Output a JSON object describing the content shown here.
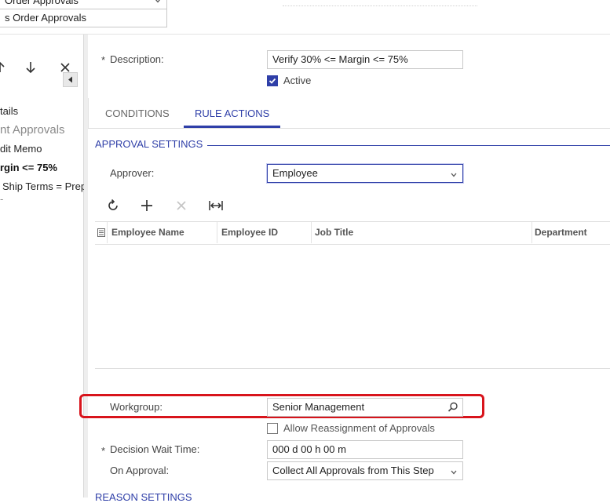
{
  "top": {
    "field1_value": "Order Approvals",
    "field2_value": "s Order Approvals"
  },
  "left": {
    "toolbar": {
      "collapse_icon": "triangle-left-icon",
      "move_up_icon": "arrow-up-icon",
      "move_down_icon": "arrow-down-icon",
      "delete_icon": "close-icon"
    },
    "tree": [
      {
        "label": "tails",
        "style": "normal"
      },
      {
        "label": "nt Approvals",
        "style": "muted"
      },
      {
        "label": "dit Memo",
        "style": "normal"
      },
      {
        "label": "rgin <= 75%",
        "style": "bold"
      },
      {
        "label": "Ship Terms = Prep",
        "style": "normal"
      },
      {
        "label": "-",
        "style": "normal"
      }
    ]
  },
  "form": {
    "description_label": "Description:",
    "description_value": "Verify 30% <= Margin <= 75%",
    "active_label": "Active",
    "active_checked": true,
    "tabs": [
      {
        "label": "CONDITIONS",
        "active": false
      },
      {
        "label": "RULE ACTIONS",
        "active": true
      }
    ],
    "approval_section_title": "APPROVAL SETTINGS",
    "approver_label": "Approver:",
    "approver_value": "Employee",
    "grid_toolbar": [
      "refresh-icon",
      "add-icon",
      "delete-icon",
      "fit-columns-icon"
    ],
    "grid_columns": [
      "Employee Name",
      "Employee ID",
      "Job Title",
      "Department"
    ],
    "workgroup_label": "Workgroup:",
    "workgroup_value": "Senior Management",
    "allow_reassign_label": "Allow Reassignment of Approvals",
    "allow_reassign_checked": false,
    "decision_wait_label": "Decision Wait Time:",
    "decision_wait_value": "000 d 00 h 00 m",
    "on_approval_label": "On Approval:",
    "on_approval_value": "Collect All Approvals from This Step",
    "reason_section_title": "REASON SETTINGS"
  },
  "colors": {
    "accent": "#2f3fa8",
    "highlight_box": "#d8141c"
  }
}
